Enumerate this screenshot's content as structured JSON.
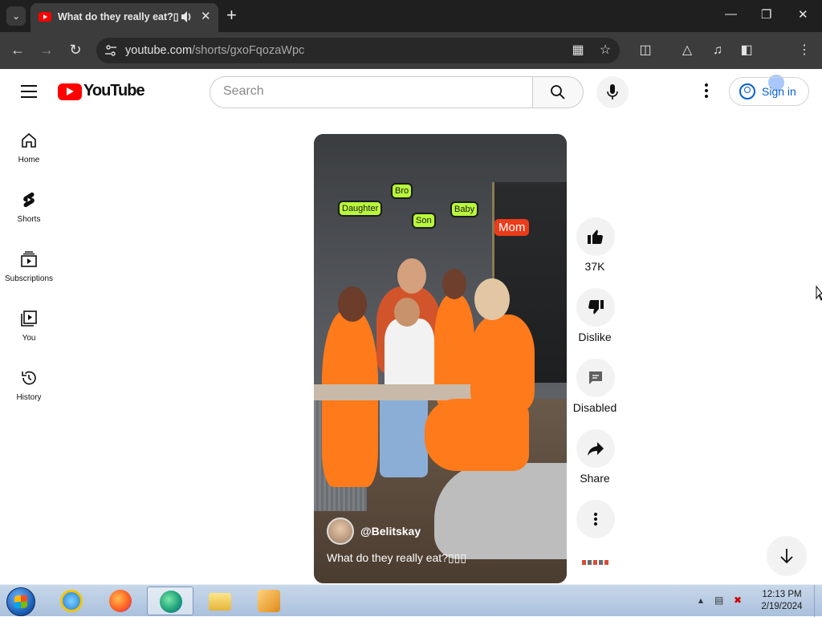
{
  "browser": {
    "tab_title": "What do they really eat?▯▯",
    "url_host": "youtube.com",
    "url_path": "/shorts/gxoFqozaWpc"
  },
  "youtube": {
    "logo_text": "YouTube",
    "search_placeholder": "Search",
    "sign_in_label": "Sign in",
    "sidebar": [
      {
        "label": "Home",
        "icon": "home-icon"
      },
      {
        "label": "Shorts",
        "icon": "shorts-icon"
      },
      {
        "label": "Subscriptions",
        "icon": "subscriptions-icon"
      },
      {
        "label": "You",
        "icon": "you-icon"
      },
      {
        "label": "History",
        "icon": "history-icon"
      }
    ]
  },
  "short": {
    "labels": {
      "bro": "Bro",
      "daughter": "Daughter",
      "son": "Son",
      "baby": "Baby",
      "mom": "Mom"
    },
    "channel": "@Belitskay",
    "caption": "What do they really eat?▯▯▯",
    "actions": {
      "like_count": "37K",
      "dislike_label": "Dislike",
      "comments_label": "Disabled",
      "share_label": "Share"
    }
  },
  "taskbar": {
    "time": "12:13 PM",
    "date": "2/19/2024"
  },
  "colors": {
    "youtube_red": "#ff0000",
    "link_blue": "#065fd4",
    "chrome_dark": "#1f1f1f",
    "tag_green": "#b8f83a",
    "outfit_orange": "#ff7a1a"
  }
}
